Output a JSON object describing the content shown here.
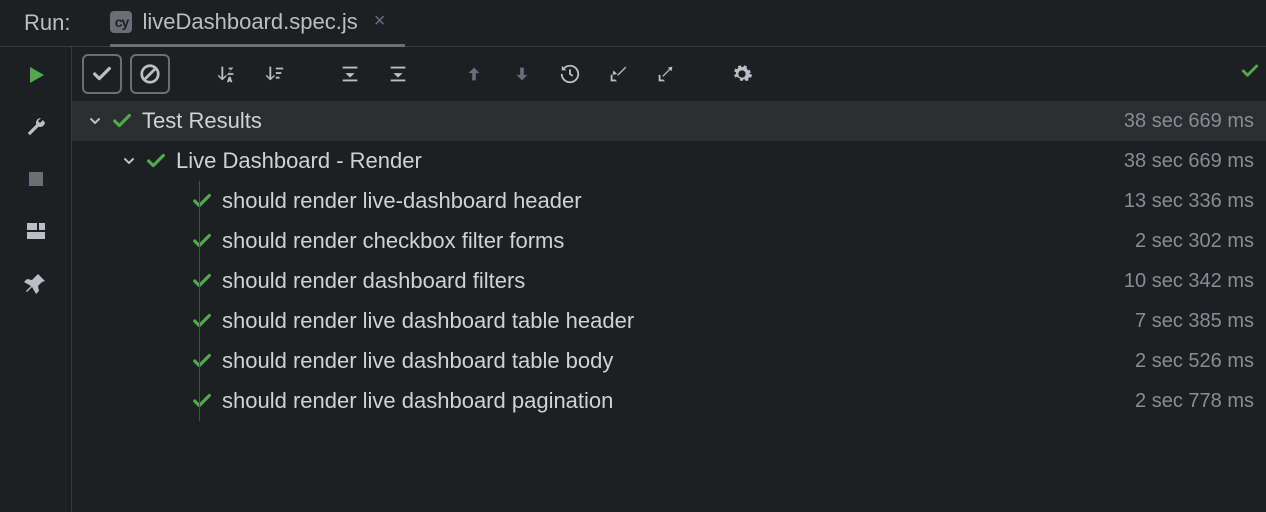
{
  "header": {
    "run_label": "Run:",
    "tab": {
      "icon_text": "cy",
      "label": "liveDashboard.spec.js"
    }
  },
  "tree": {
    "root": {
      "label": "Test Results",
      "timing": "38 sec 669 ms"
    },
    "suite": {
      "label": "Live Dashboard - Render",
      "timing": "38 sec 669 ms"
    },
    "tests": [
      {
        "label": "should render live-dashboard header",
        "timing": "13 sec 336 ms"
      },
      {
        "label": "should render checkbox filter forms",
        "timing": "2 sec 302 ms"
      },
      {
        "label": "should render dashboard filters",
        "timing": "10 sec 342 ms"
      },
      {
        "label": "should render live dashboard table header",
        "timing": "7 sec 385 ms"
      },
      {
        "label": "should render live dashboard table body",
        "timing": "2 sec 526 ms"
      },
      {
        "label": "should render live dashboard pagination",
        "timing": "2 sec 778 ms"
      }
    ]
  }
}
